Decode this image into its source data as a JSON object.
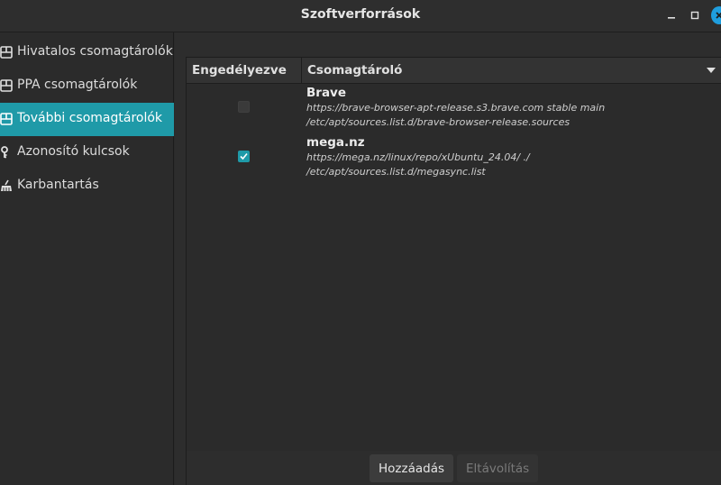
{
  "window": {
    "title": "Szoftverforrások"
  },
  "sidebar": {
    "items": [
      {
        "label": "Hivatalos csomagtárolók",
        "icon": "repository-icon",
        "active": false
      },
      {
        "label": "PPA csomagtárolók",
        "icon": "repository-icon",
        "active": false
      },
      {
        "label": "További csomagtárolók",
        "icon": "repository-icon",
        "active": true
      },
      {
        "label": "Azonosító kulcsok",
        "icon": "key-icon",
        "active": false
      },
      {
        "label": "Karbantartás",
        "icon": "broom-icon",
        "active": false
      }
    ]
  },
  "table": {
    "columns": {
      "enabled": "Engedélyezve",
      "repository": "Csomagtároló"
    },
    "rows": [
      {
        "enabled": false,
        "name": "Brave",
        "url": "https://brave-browser-apt-release.s3.brave.com stable main",
        "file": "/etc/apt/sources.list.d/brave-browser-release.sources"
      },
      {
        "enabled": true,
        "name": "mega.nz",
        "url": "https://mega.nz/linux/repo/xUbuntu_24.04/ ./",
        "file": "/etc/apt/sources.list.d/megasync.list"
      }
    ]
  },
  "footer": {
    "add_label": "Hozzáadás",
    "remove_label": "Eltávolítás"
  },
  "colors": {
    "accent": "#1f9aa8",
    "close_button": "#1f9ede"
  }
}
